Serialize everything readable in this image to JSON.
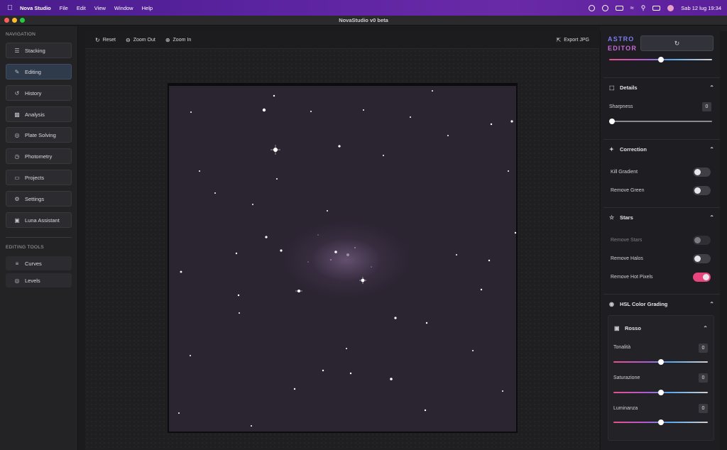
{
  "menubar": {
    "app_name": "Nova Studio",
    "menus": [
      "File",
      "Edit",
      "View",
      "Window",
      "Help"
    ],
    "datetime": "Sab 12 lug  19:34"
  },
  "window": {
    "title": "NovaStudio v0 beta"
  },
  "sidebar": {
    "nav_title": "NAVIGATION",
    "items": [
      {
        "label": "Stacking",
        "icon": "layers-icon"
      },
      {
        "label": "Editing",
        "icon": "edit-icon"
      },
      {
        "label": "History",
        "icon": "history-icon"
      },
      {
        "label": "Analysis",
        "icon": "bar-chart-icon"
      },
      {
        "label": "Plate Solving",
        "icon": "target-icon"
      },
      {
        "label": "Photometry",
        "icon": "gauge-icon"
      },
      {
        "label": "Projects",
        "icon": "folder-icon"
      },
      {
        "label": "Settings",
        "icon": "gear-icon"
      },
      {
        "label": "Luna Assistant",
        "icon": "assistant-icon"
      }
    ],
    "active_item": "Editing",
    "tools_title": "EDITING TOOLS",
    "tools": [
      {
        "label": "Curves",
        "icon": "sliders-icon"
      },
      {
        "label": "Levels",
        "icon": "levels-icon"
      }
    ]
  },
  "toolbar": {
    "reset": "Reset",
    "zoom_out": "Zoom Out",
    "zoom_in": "Zoom In",
    "export": "Export JPG"
  },
  "panel": {
    "logo_line1": "ASTRO",
    "logo_line2": "EDITOR",
    "top_slider_value": 0.5,
    "details": {
      "title": "Details",
      "sharpness_label": "Sharpness",
      "sharpness_value": "0"
    },
    "correction": {
      "title": "Correction",
      "kill_gradient": "Kill Gradient",
      "kill_gradient_on": false,
      "remove_green": "Remove Green",
      "remove_green_on": false
    },
    "stars": {
      "title": "Stars",
      "remove_stars": "Remove Stars",
      "remove_stars_on": false,
      "remove_halos": "Remove Halos",
      "remove_halos_on": false,
      "remove_hot_pixels": "Remove Hot Pixels",
      "remove_hot_pixels_on": true
    },
    "hsl": {
      "title": "HSL Color Grading",
      "channel": "Rosso",
      "hue_label": "Tonalità",
      "hue_value": "0",
      "sat_label": "Saturazione",
      "sat_value": "0",
      "lum_label": "Luminanza",
      "lum_value": "0"
    }
  },
  "colors": {
    "accent": "#e8457e",
    "active_nav": "#2f3a4a",
    "menubar": "#5a23a0"
  }
}
